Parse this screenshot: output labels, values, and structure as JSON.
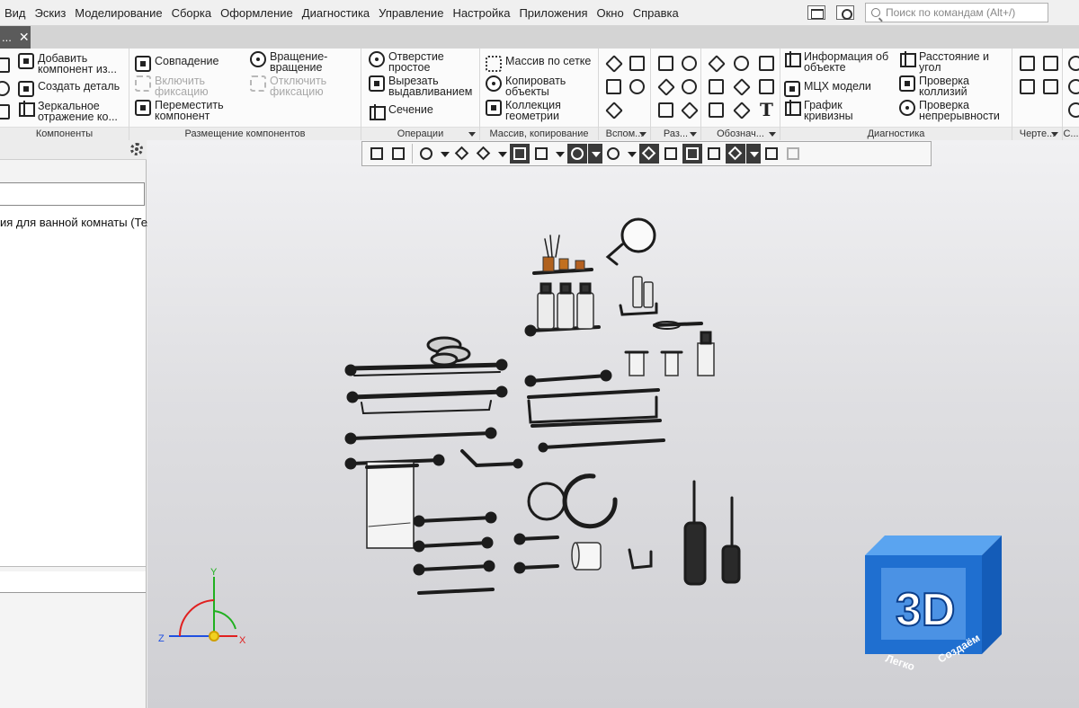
{
  "menu": {
    "items": [
      "Вид",
      "Эскиз",
      "Моделирование",
      "Сборка",
      "Оформление",
      "Диагностика",
      "Управление",
      "Настройка",
      "Приложения",
      "Окно",
      "Справка"
    ],
    "search_placeholder": "Поиск по командам (Alt+/)"
  },
  "doc_tab": {
    "label": "...",
    "close": "✕"
  },
  "ribbon": {
    "components": {
      "caption": "Компоненты",
      "add": "Добавить компонент из...",
      "create": "Создать деталь",
      "mirror": "Зеркальное отражение ко..."
    },
    "placement": {
      "caption": "Размещение компонентов",
      "coincidence": "Совпадение",
      "enable_fix": "Включить фиксацию",
      "move": "Переместить компонент",
      "rotate": "Вращение-вращение",
      "disable_fix": "Отключить фиксацию"
    },
    "operations": {
      "caption": "Операции",
      "hole": "Отверстие простое",
      "extrude_cut": "Вырезать выдавливанием",
      "section": "Сечение"
    },
    "arrays": {
      "caption": "Массив, копирование",
      "grid_array": "Массив по сетке",
      "copy_objects": "Копировать объекты",
      "geometry_collection": "Коллекция геометрии"
    },
    "aux": {
      "caption": "Вспом..."
    },
    "sizes": {
      "caption": "Раз..."
    },
    "notation": {
      "caption": "Обознач..."
    },
    "diagnostics": {
      "caption": "Диагностика",
      "object_info": "Информация об объекте",
      "distance_angle": "Расстояние и угол",
      "mass_props": "МЦХ модели",
      "collision_check": "Проверка коллизий",
      "curvature_graph": "График кривизны",
      "continuity_check": "Проверка непрерывности"
    },
    "drawing": {
      "caption": "Черте..."
    },
    "last": {
      "caption": "С..."
    }
  },
  "tree": {
    "root_item": "ия для ванной комнаты (Тел"
  },
  "triad": {
    "x": "X",
    "y": "Y",
    "z": "Z"
  },
  "logo": {
    "text": "3D",
    "bottom_left": "Легко",
    "bottom_right": "Создаём"
  },
  "colors": {
    "viewport_top": "#f1f1f3",
    "viewport_bottom": "#cfcfd3",
    "logo_blue": "#1f6fd0",
    "axis_x": "#e02020",
    "axis_y": "#20b020",
    "axis_z": "#2050e0"
  }
}
